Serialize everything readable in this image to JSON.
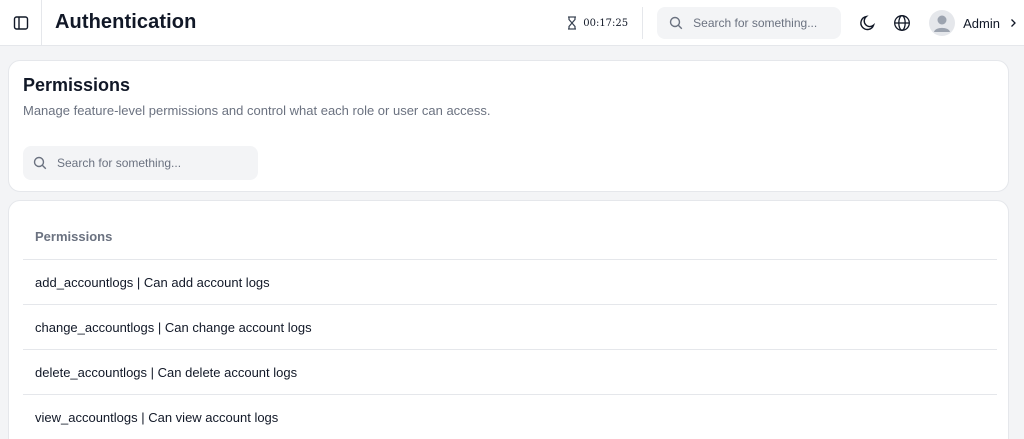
{
  "header": {
    "title": "Authentication",
    "timer": "00:17:25",
    "search_placeholder": "Search for something...",
    "user_name": "Admin"
  },
  "permissions_card": {
    "title": "Permissions",
    "subtitle": "Manage feature-level permissions and control what each role or user can access.",
    "search_placeholder": "Search for something..."
  },
  "permissions_list": {
    "column_header": "Permissions",
    "items": [
      "add_accountlogs | Can add account logs",
      "change_accountlogs | Can change account logs",
      "delete_accountlogs | Can delete account logs",
      "view_accountlogs | Can view account logs"
    ]
  },
  "icons": {
    "sidebar_toggle": "sidebar-icon",
    "timer": "hourglass-icon",
    "search": "search-icon",
    "theme": "moon-icon",
    "language": "globe-icon",
    "avatar": "user-icon",
    "user_menu": "chevron-right-icon"
  }
}
